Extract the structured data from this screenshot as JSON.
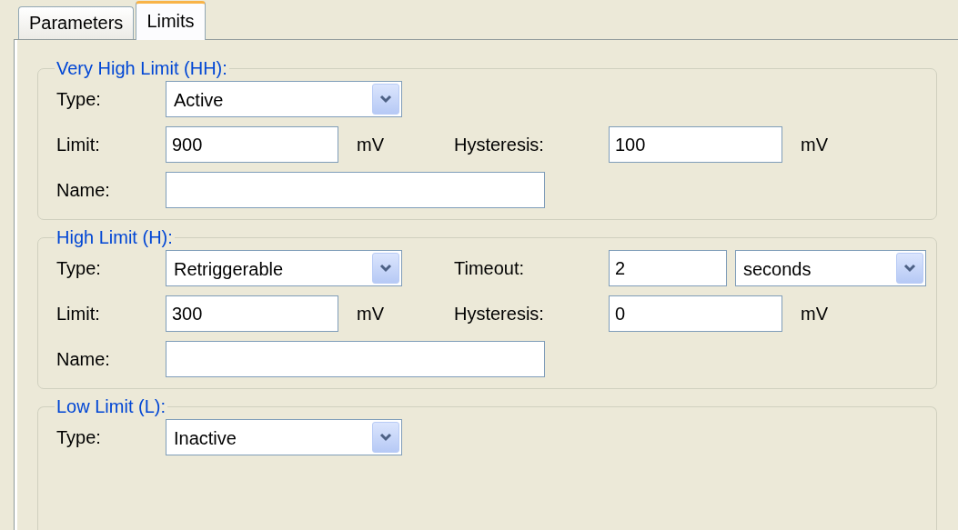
{
  "tabs": [
    {
      "label": "Parameters",
      "selected": false
    },
    {
      "label": "Limits",
      "selected": true
    }
  ],
  "groups": [
    {
      "title": "Very High Limit (HH):",
      "type": {
        "label": "Type:",
        "value": "Active"
      },
      "limit": {
        "label": "Limit:",
        "value": "900",
        "unit": "mV"
      },
      "hysteresis": {
        "label": "Hysteresis:",
        "value": "100",
        "unit": "mV"
      },
      "name": {
        "label": "Name:"
      }
    },
    {
      "title": "High Limit (H):",
      "type": {
        "label": "Type:",
        "value": "Retriggerable"
      },
      "timeout": {
        "label": "Timeout:",
        "value": "2",
        "unit": "seconds"
      },
      "limit": {
        "label": "Limit:",
        "value": "300",
        "unit": "mV"
      },
      "hysteresis": {
        "label": "Hysteresis:",
        "value": "0",
        "unit": "mV"
      },
      "name": {
        "label": "Name:"
      }
    },
    {
      "title": "Low Limit (L):",
      "type": {
        "label": "Type:",
        "value": "Inactive"
      }
    }
  ]
}
